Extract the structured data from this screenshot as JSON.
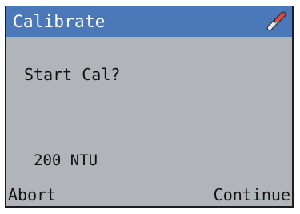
{
  "header": {
    "title": "Calibrate",
    "icon": "calibration-probe-icon",
    "icon_colors": {
      "tip": "#e2473f",
      "body": "#efefef",
      "outline": "#2b3136"
    }
  },
  "main": {
    "prompt": "Start Cal?",
    "standard_value": "200 NTU"
  },
  "softkeys": {
    "left_label": "Abort",
    "right_label": "Continue"
  },
  "colors": {
    "title_bar": "#4a78b8",
    "screen_background": "#b1b4b9",
    "text": "#111111"
  }
}
